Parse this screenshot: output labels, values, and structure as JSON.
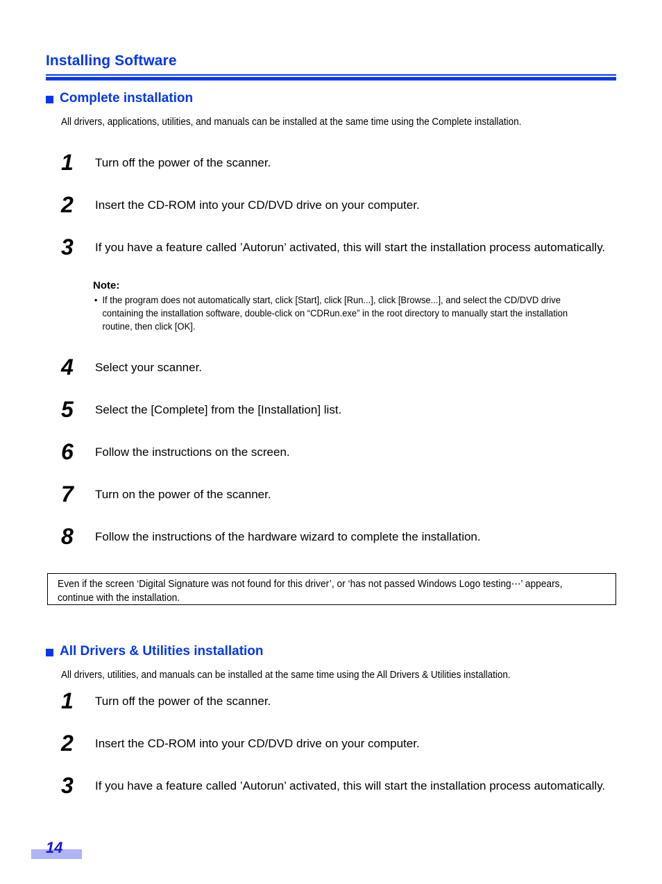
{
  "document": {
    "chapter_title": "Installing Software",
    "page_number": "14"
  },
  "sections": [
    {
      "id": "complete-installation",
      "heading": "Complete installation",
      "lead": "All drivers, applications, utilities, and manuals can be installed at the same time using the Complete installation.",
      "steps": [
        {
          "number": "1",
          "text": "Turn off the power of the scanner."
        },
        {
          "number": "2",
          "text": "Insert the CD-ROM into your CD/DVD drive on your computer."
        },
        {
          "number": "3",
          "text": "If you have a feature called ’Autorun’ activated, this will start the installation process automatically."
        },
        {
          "number": "4",
          "text": "Select your scanner."
        },
        {
          "number": "5",
          "text": "Select the [Complete] from the [Installation] list."
        },
        {
          "number": "6",
          "text": "Follow the instructions on the screen."
        },
        {
          "number": "7",
          "text": "Turn on the power of the scanner."
        },
        {
          "number": "8",
          "text": "Follow the instructions of the hardware wizard to complete the installation."
        }
      ]
    },
    {
      "id": "all-drivers-utilities-installation",
      "heading": "All Drivers & Utilities installation",
      "lead": "All drivers, utilities, and manuals can be installed at the same time using the All Drivers & Utilities installation.",
      "steps": [
        {
          "number": "1",
          "text": "Turn off the power of the scanner."
        },
        {
          "number": "2",
          "text": "Insert the CD-ROM into your CD/DVD drive on your computer."
        },
        {
          "number": "3",
          "text": "If you have a feature called ’Autorun’ activated, this will start the installation process automatically."
        }
      ]
    }
  ],
  "note": {
    "title": "Note:",
    "bullet_glyph": "•",
    "items": [
      "If the program does not automatically start, click [Start], click [Run...], click [Browse...], and select the CD/DVD drive containing the installation software, double-click on “CDRun.exe” in the root directory to manually start the installation routine, then click [OK]."
    ]
  },
  "callout": {
    "text": "Even if the screen ‘Digital Signature was not found for this driver’, or ‘has not passed Windows Logo testing⋯’ appears, continue with the installation."
  },
  "colors": {
    "heading_blue": "#0037f5",
    "page_number_blue": "#1616e0",
    "footer_bar": "#aeb4f7",
    "text_black": "#000000"
  }
}
